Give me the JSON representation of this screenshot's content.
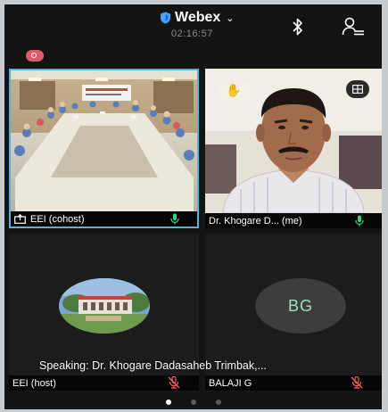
{
  "header": {
    "app_name": "Webex",
    "timer": "02:16:57"
  },
  "tiles": [
    {
      "name": "EEI (cohost)",
      "mic": "on",
      "video": "meeting-room",
      "active_speaker_border": true
    },
    {
      "name": "Dr. Khogare D... (me)",
      "mic": "on",
      "video": "participant-camera",
      "hand_raised": true
    },
    {
      "name": "EEI (host)",
      "mic": "muted",
      "avatar": "building-photo"
    },
    {
      "name": "BALAJI G",
      "mic": "muted",
      "avatar_initials": "BG"
    }
  ],
  "speaking": "Speaking: Dr. Khogare Dadasaheb Trimbak,...",
  "pager": {
    "pages": 3,
    "current": 1
  },
  "colors": {
    "background": "#141414",
    "active_border": "#5fb0d6",
    "mic_on": "#2ed67c",
    "mic_muted": "#ff5c5c",
    "recording": "#e05a6a",
    "initials": "#9de4bc"
  }
}
